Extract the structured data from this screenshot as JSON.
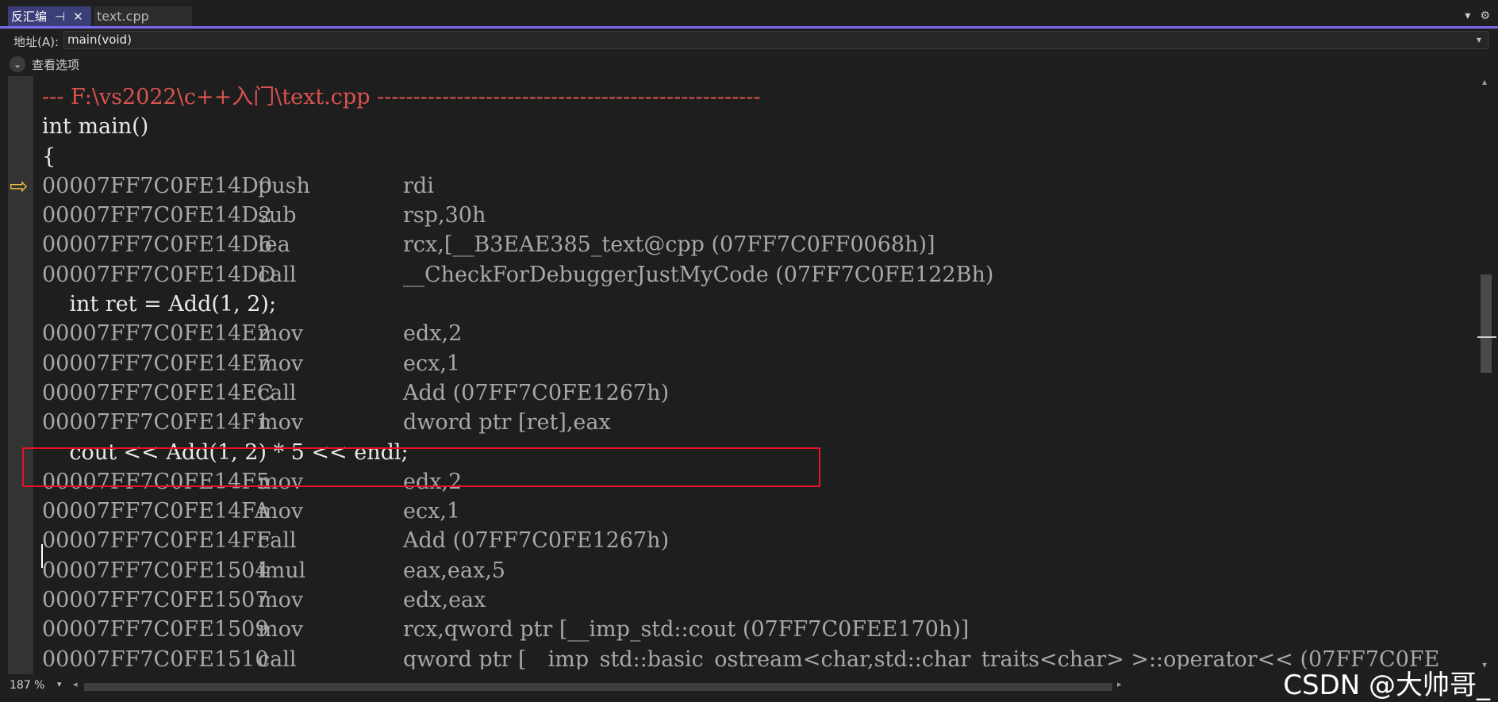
{
  "tabs": {
    "active": "反汇编",
    "active_pin": "⊣",
    "active_close": "✕",
    "inactive": "text.cpp",
    "menu_icon": "▾",
    "gear_icon": "⚙"
  },
  "address": {
    "label": "地址(A):",
    "value": "main(void)",
    "dropdown_icon": "▾"
  },
  "view_options": {
    "label": "查看选项",
    "toggle_icon": "⌄"
  },
  "code": {
    "header": "--- F:\\vs2022\\c++入门\\text.cpp -----------------------------------------------------",
    "lines": [
      {
        "kind": "src",
        "text": "int main()"
      },
      {
        "kind": "src",
        "text": "{"
      },
      {
        "kind": "asm",
        "addr": "00007FF7C0FE14D0",
        "mnem": "push",
        "ops": "rdi"
      },
      {
        "kind": "asm",
        "addr": "00007FF7C0FE14D2",
        "mnem": "sub",
        "ops": "rsp,30h"
      },
      {
        "kind": "asm",
        "addr": "00007FF7C0FE14D6",
        "mnem": "lea",
        "ops": "rcx,[__B3EAE385_text@cpp (07FF7C0FF0068h)]"
      },
      {
        "kind": "asm",
        "addr": "00007FF7C0FE14DD",
        "mnem": "call",
        "ops": "__CheckForDebuggerJustMyCode (07FF7C0FE122Bh)"
      },
      {
        "kind": "src",
        "text": "    int ret = Add(1, 2);"
      },
      {
        "kind": "asm",
        "addr": "00007FF7C0FE14E2",
        "mnem": "mov",
        "ops": "edx,2"
      },
      {
        "kind": "asm",
        "addr": "00007FF7C0FE14E7",
        "mnem": "mov",
        "ops": "ecx,1"
      },
      {
        "kind": "asm",
        "addr": "00007FF7C0FE14EC",
        "mnem": "call",
        "ops": "Add (07FF7C0FE1267h)"
      },
      {
        "kind": "asm",
        "addr": "00007FF7C0FE14F1",
        "mnem": "mov",
        "ops": "dword ptr [ret],eax"
      },
      {
        "kind": "src",
        "text": "    cout << Add(1, 2) * 5 << endl;"
      },
      {
        "kind": "asm",
        "addr": "00007FF7C0FE14F5",
        "mnem": "mov",
        "ops": "edx,2"
      },
      {
        "kind": "asm",
        "addr": "00007FF7C0FE14FA",
        "mnem": "mov",
        "ops": "ecx,1"
      },
      {
        "kind": "asm",
        "addr": "00007FF7C0FE14FF",
        "mnem": "call",
        "ops": "Add (07FF7C0FE1267h)"
      },
      {
        "kind": "asm",
        "addr": "00007FF7C0FE1504",
        "mnem": "imul",
        "ops": "eax,eax,5"
      },
      {
        "kind": "asm",
        "addr": "00007FF7C0FE1507",
        "mnem": "mov",
        "ops": "edx,eax"
      },
      {
        "kind": "asm",
        "addr": "00007FF7C0FE1509",
        "mnem": "mov",
        "ops": "rcx,qword ptr [__imp_std::cout (07FF7C0FEE170h)]"
      },
      {
        "kind": "asm",
        "addr": "00007FF7C0FE1510",
        "mnem": "call",
        "ops": "qword ptr [__imp_std::basic_ostream<char,std::char_traits<char> >::operator<< (07FF7C0FE"
      }
    ],
    "current_line_arrow": "⇨",
    "current_line_index": 2
  },
  "scrollbar": {
    "up_icon": "▴",
    "down_icon": "▾",
    "left_icon": "◂",
    "right_icon": "▸"
  },
  "statusbar": {
    "zoom": "187 %",
    "zoom_drop_icon": "▾"
  },
  "watermark": "CSDN @大帅哥_",
  "colors": {
    "accent": "#7b68ee",
    "highlight_box": "#e81123",
    "header_text": "#d9534f",
    "arrow": "#f0c040"
  }
}
